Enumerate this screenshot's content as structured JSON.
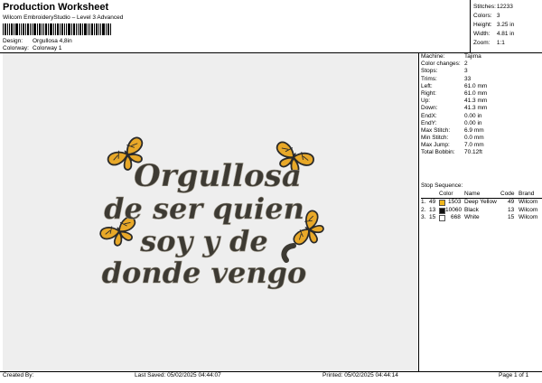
{
  "header": {
    "title": "Production Worksheet",
    "subtitle": "Wilcom EmbroideryStudio – Level 3 Advanced",
    "design_label": "Design:",
    "design_value": "Orgullosa 4,8in",
    "colorway_label": "Colorway:",
    "colorway_value": "Colorway 1"
  },
  "summary": [
    {
      "label": "Stitches:",
      "value": "12233"
    },
    {
      "label": "Colors:",
      "value": "3"
    },
    {
      "label": "Height:",
      "value": "3.25 in"
    },
    {
      "label": "Width:",
      "value": "4.81 in"
    },
    {
      "label": "Zoom:",
      "value": "1:1"
    }
  ],
  "design_text": [
    "Orgullosa",
    "de ser quien",
    "soy y de",
    "donde vengo"
  ],
  "details": [
    {
      "label": "Machine:",
      "value": "Tajima"
    },
    {
      "label": "Color changes:",
      "value": "2"
    },
    {
      "label": "Stops:",
      "value": "3"
    },
    {
      "label": "Trims:",
      "value": "33"
    },
    {
      "label": "Left:",
      "value": "61.0 mm"
    },
    {
      "label": "Right:",
      "value": "61.0 mm"
    },
    {
      "label": "Up:",
      "value": "41.3 mm"
    },
    {
      "label": "Down:",
      "value": "41.3 mm"
    },
    {
      "label": "EndX:",
      "value": "0.00 in"
    },
    {
      "label": "EndY:",
      "value": "0.00 in"
    },
    {
      "label": "Max Stitch:",
      "value": "6.9 mm"
    },
    {
      "label": "Min Stitch:",
      "value": "0.0 mm"
    },
    {
      "label": "Max Jump:",
      "value": "7.0 mm"
    },
    {
      "label": "Total Bobbin:",
      "value": "70.12ft"
    }
  ],
  "stop_sequence": {
    "title": "Stop Sequence:",
    "columns": [
      "Color",
      "Name",
      "Code",
      "Brand"
    ],
    "rows": [
      {
        "stop": "1.",
        "count": "49",
        "color": "#f1b71c",
        "num": "1503",
        "name": "Deep Yellow",
        "code": "49",
        "brand": "Wilcom"
      },
      {
        "stop": "2.",
        "count": "13",
        "color": "#111111",
        "num": "10060",
        "name": "Black",
        "code": "13",
        "brand": "Wilcom"
      },
      {
        "stop": "3.",
        "count": "15",
        "color": "#ffffff",
        "num": "668",
        "name": "White",
        "code": "15",
        "brand": "Wilcom"
      }
    ]
  },
  "footer": {
    "created_by": "Created By:",
    "last_saved": "Last Saved: 05/02/2025 04:44:07",
    "printed": "Printed: 05/02/2025 04:44:14",
    "page": "Page 1 of 1"
  }
}
